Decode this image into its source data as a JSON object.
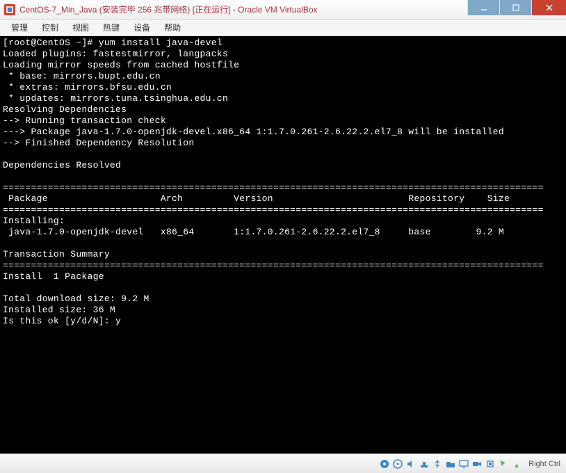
{
  "window": {
    "title": "CentOS-7_Min_Java (安装完毕 256 兆带网络) [正在运行] - Oracle VM VirtualBox"
  },
  "menu": {
    "manage": "管理",
    "control": "控制",
    "view": "视图",
    "hotkey": "热键",
    "device": "设备",
    "help": "帮助"
  },
  "terminal": {
    "prompt": "[root@CentOS ~]# ",
    "command": "yum install java-devel",
    "lines": [
      "Loaded plugins: fastestmirror, langpacks",
      "Loading mirror speeds from cached hostfile",
      " * base: mirrors.bupt.edu.cn",
      " * extras: mirrors.bfsu.edu.cn",
      " * updates: mirrors.tuna.tsinghua.edu.cn",
      "Resolving Dependencies",
      "--> Running transaction check",
      "---> Package java-1.7.0-openjdk-devel.x86_64 1:1.7.0.261-2.6.22.2.el7_8 will be installed",
      "--> Finished Dependency Resolution",
      "",
      "Dependencies Resolved",
      ""
    ],
    "table_header": " Package                    Arch         Version                        Repository    Size",
    "table_section": "Installing:",
    "table_row": " java-1.7.0-openjdk-devel   x86_64       1:1.7.0.261-2.6.22.2.el7_8     base        9.2 M",
    "summary_header": "Transaction Summary",
    "summary": [
      "Install  1 Package",
      "",
      "Total download size: 9.2 M",
      "Installed size: 36 M"
    ],
    "prompt_confirm": "Is this ok [y/d/N]: ",
    "confirm_value": "y"
  },
  "statusbar": {
    "host_key": "Right Ctrl"
  },
  "colors": {
    "accent": "#a83240",
    "close": "#c84030",
    "terminal_bg": "#000",
    "terminal_fg": "#fff",
    "status_icon": "#3a87c8"
  }
}
